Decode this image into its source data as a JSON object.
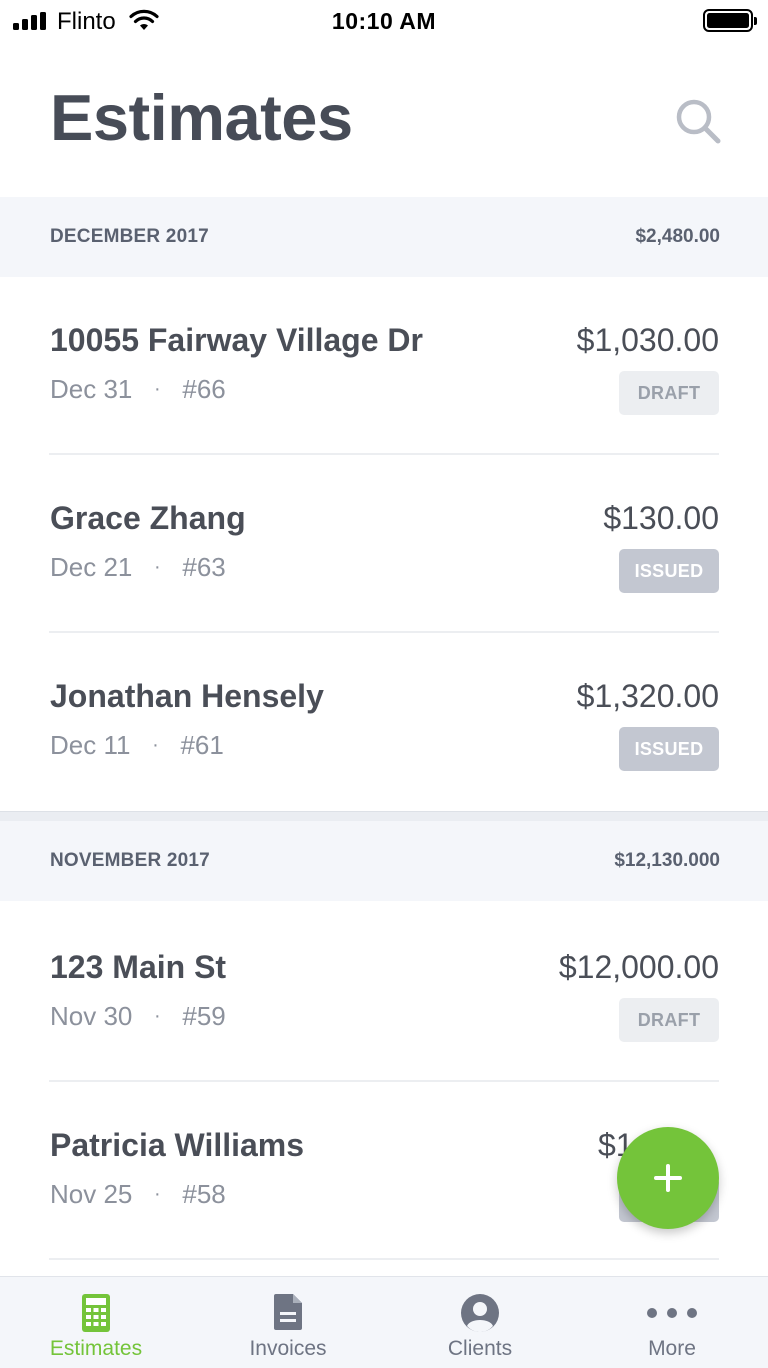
{
  "status_bar": {
    "carrier": "Flinto",
    "time": "10:10 AM"
  },
  "header": {
    "title": "Estimates",
    "search_icon": "search-icon"
  },
  "sections": [
    {
      "label": "DECEMBER 2017",
      "total": "$2,480.00",
      "items": [
        {
          "name": "10055 Fairway Village Dr",
          "date": "Dec 31",
          "number": "#66",
          "amount": "$1,030.00",
          "status": "DRAFT"
        },
        {
          "name": "Grace Zhang",
          "date": "Dec 21",
          "number": "#63",
          "amount": "$130.00",
          "status": "ISSUED"
        },
        {
          "name": "Jonathan Hensely",
          "date": "Dec 11",
          "number": "#61",
          "amount": "$1,320.00",
          "status": "ISSUED"
        }
      ]
    },
    {
      "label": "NOVEMBER 2017",
      "total": "$12,130.000",
      "items": [
        {
          "name": "123 Main St",
          "date": "Nov 30",
          "number": "#59",
          "amount": "$12,000.00",
          "status": "DRAFT"
        },
        {
          "name": "Patricia Williams",
          "date": "Nov 25",
          "number": "#58",
          "amount": "$1",
          "status": ""
        }
      ]
    }
  ],
  "meta_separator": "·",
  "fab": {
    "icon": "plus-icon"
  },
  "tab_bar": {
    "tabs": [
      {
        "label": "Estimates",
        "icon": "calculator-icon",
        "active": true
      },
      {
        "label": "Invoices",
        "icon": "document-icon",
        "active": false
      },
      {
        "label": "Clients",
        "icon": "user-icon",
        "active": false
      },
      {
        "label": "More",
        "icon": "more-dots-icon",
        "active": false
      }
    ]
  },
  "colors": {
    "accent": "#74c43a",
    "section_bg": "#f4f6fa",
    "badge_draft": "#eceef1",
    "badge_issued": "#c3c7d1"
  }
}
